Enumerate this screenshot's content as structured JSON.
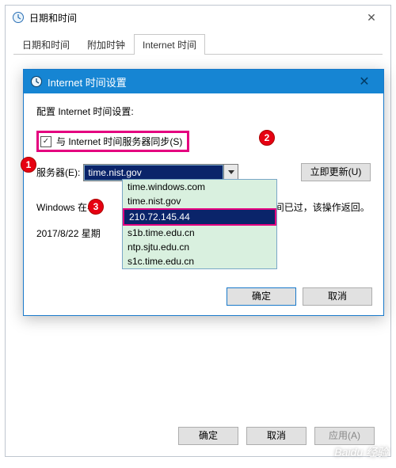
{
  "outer": {
    "title": "日期和时间",
    "close": "✕",
    "tabs": [
      "日期和时间",
      "附加时钟",
      "Internet 时间"
    ],
    "active_tab": 2,
    "footer": {
      "ok": "确定",
      "cancel": "取消",
      "apply": "应用(A)"
    }
  },
  "inner": {
    "title": "Internet 时间设置",
    "close": "✕",
    "config_label": "配置 Internet 时间设置:",
    "sync_label": "与 Internet 时间服务器同步(S)",
    "server_label": "服务器(E):",
    "server_value": "time.nist.gov",
    "update_btn": "立即更新(U)",
    "options": [
      "time.windows.com",
      "time.nist.gov",
      "210.72.145.44",
      "s1b.time.edu.cn",
      "ntp.sjtu.edu.cn",
      "s1c.time.edu.cn"
    ],
    "selected_option": 2,
    "back_text_left": "Windows 在与",
    "back_text_right": "于超时时间已过，该操作返回。",
    "back_date": "2017/8/22 星期",
    "footer": {
      "ok": "确定",
      "cancel": "取消"
    }
  },
  "badges": {
    "b1": "1",
    "b2": "2",
    "b3": "3"
  },
  "watermark": "Baidu 经验"
}
